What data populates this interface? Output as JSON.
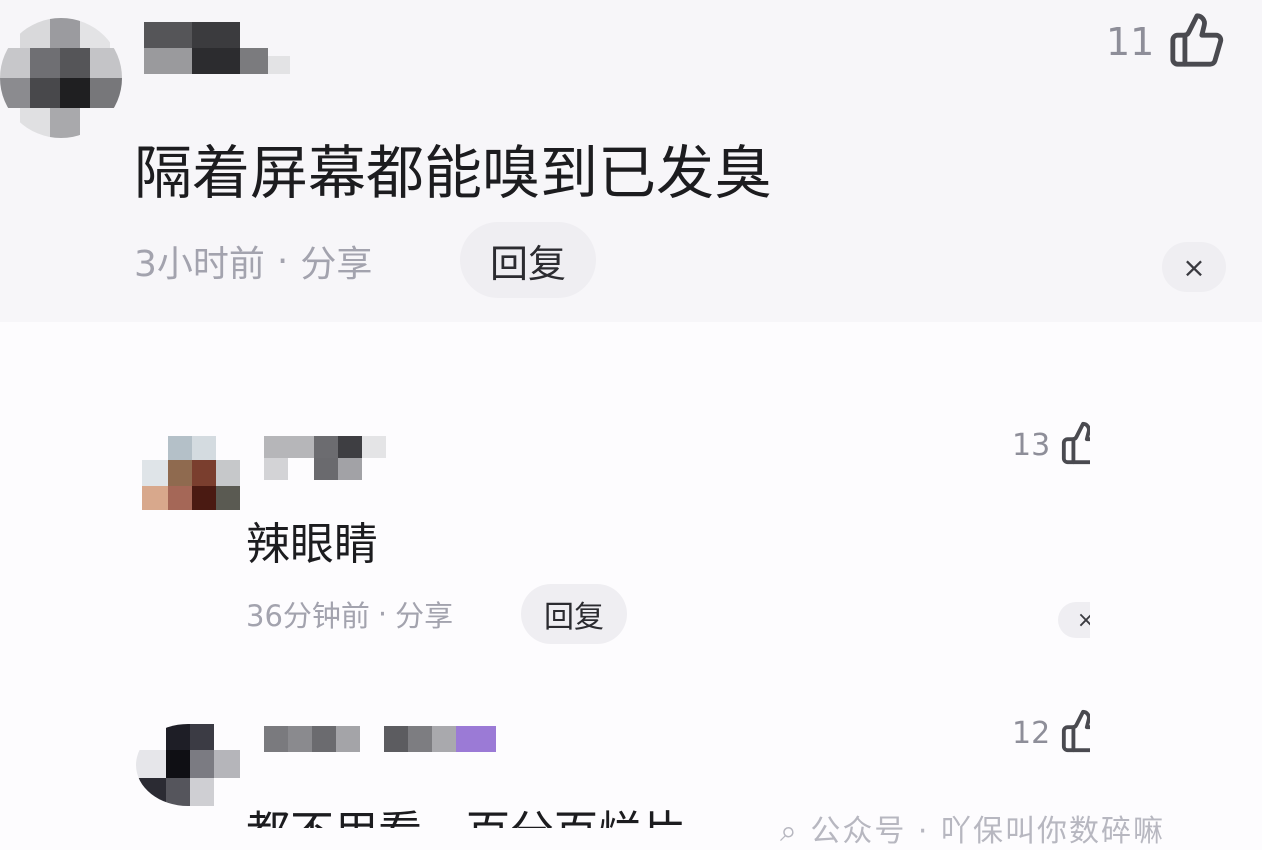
{
  "comments": [
    {
      "likes": "11",
      "text": "隔着屏幕都能嗅到已发臭",
      "time": "3小时前",
      "separator": "·",
      "share": "分享",
      "reply": "回复",
      "close": "×"
    }
  ],
  "replies": [
    {
      "likes": "13",
      "text": "辣眼睛",
      "time": "36分钟前",
      "separator": "·",
      "share": "分享",
      "reply": "回复",
      "close": "×"
    },
    {
      "likes": "12",
      "text": "都不用看，百分百烂片"
    }
  ],
  "watermark": "⌕ 公众号 · 吖保叫你数碎嘛",
  "icons": {
    "like": "thumbs-up-icon",
    "close": "close-icon"
  },
  "colors": {
    "meta": "#a3a3ae",
    "text": "#1c1c1f",
    "pill": "#efeef2"
  }
}
